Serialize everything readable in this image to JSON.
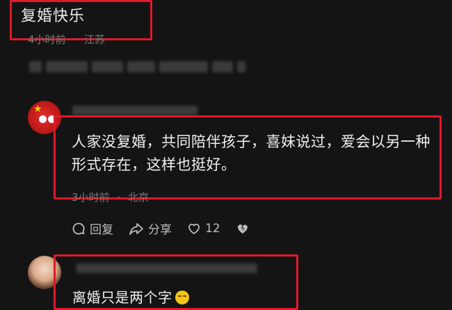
{
  "comment1": {
    "text": "复婚快乐",
    "time": "4小时前",
    "location": "江苏"
  },
  "comment2": {
    "text": "人家没复婚，共同陪伴孩子，喜妹说过，爱会以另一种形式存在，这样也挺好。",
    "time": "3小时前",
    "location": "北京",
    "actions": {
      "reply_label": "回复",
      "share_label": "分享",
      "like_count": "12"
    }
  },
  "comment3": {
    "text": "离婚只是两个字"
  },
  "colors": {
    "highlight_box": "#e0192b",
    "background": "#141414"
  }
}
